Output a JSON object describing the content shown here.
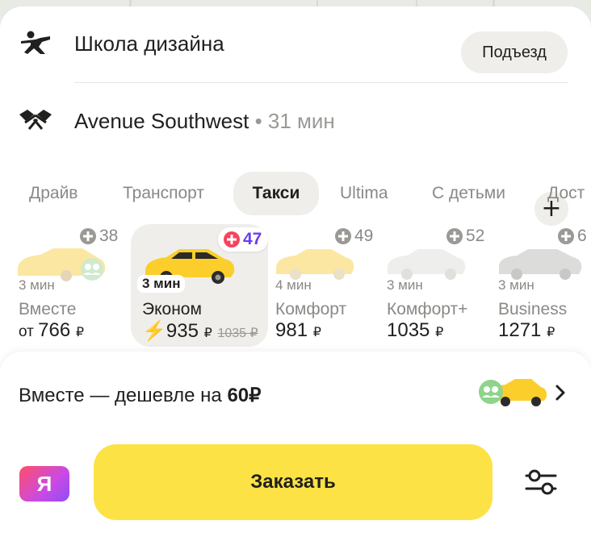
{
  "route": {
    "from": {
      "label": "Школа дизайна",
      "entrance_label": "Подъезд",
      "icon": "pedestrian-icon"
    },
    "to": {
      "label": "Avenue Southwest",
      "time": " • 31 мин",
      "icon": "finish-flags-icon",
      "add_icon": "plus-icon"
    }
  },
  "tabs": [
    {
      "label": "Драйв"
    },
    {
      "label": "Транспорт"
    },
    {
      "label": "Такси",
      "active": true
    },
    {
      "label": "Ultima"
    },
    {
      "label": "С детьми"
    },
    {
      "label": "Дост"
    }
  ],
  "tariffs": [
    {
      "name": "Вместе",
      "eta": "3 мин",
      "price_prefix": "от ",
      "price": "766",
      "currency": "₽",
      "badge": "38"
    },
    {
      "name": "Эконом",
      "eta": "3 мин",
      "bolt": "⚡",
      "price": "935",
      "old_price": "1035",
      "currency": "₽",
      "badge": "47",
      "active": true
    },
    {
      "name": "Комфорт",
      "eta": "4 мин",
      "price": "981",
      "currency": "₽",
      "badge": "49"
    },
    {
      "name": "Комфорт+",
      "eta": "3 мин",
      "price": "1035",
      "currency": "₽",
      "badge": "52"
    },
    {
      "name": "Business",
      "eta": "3 мин",
      "price": "1271",
      "currency": "₽",
      "badge": "6"
    }
  ],
  "promo": {
    "text": "Вместе — дешевле на ",
    "amount": "60₽"
  },
  "actions": {
    "order_label": "Заказать",
    "yandex_label": "Я",
    "settings_icon": "sliders-icon"
  },
  "colors": {
    "accent_yellow": "#fce245",
    "promo_purple": "#6b3df2",
    "plus_red": "#f2455c"
  }
}
